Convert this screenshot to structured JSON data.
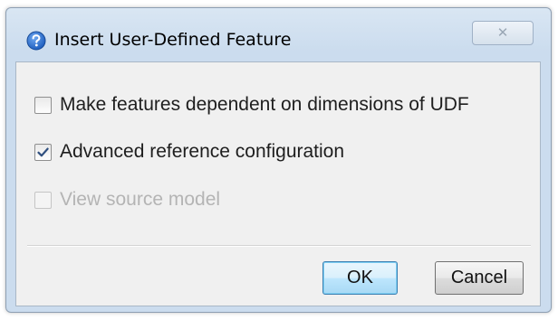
{
  "window": {
    "title": "Insert User-Defined Feature",
    "close_symbol": "✕"
  },
  "options": [
    {
      "label": "Make features dependent on dimensions of UDF",
      "checked": false,
      "enabled": true
    },
    {
      "label": "Advanced reference configuration",
      "checked": true,
      "enabled": true
    },
    {
      "label": "View source model",
      "checked": false,
      "enabled": false
    }
  ],
  "buttons": {
    "ok_label": "OK",
    "cancel_label": "Cancel"
  },
  "icons": {
    "title_icon": "help-question-icon",
    "check_icon": "checkmark-icon",
    "close_icon": "close-icon"
  },
  "colors": {
    "title_bar": "#cbdcee",
    "content_bg": "#f0f0f0",
    "help_icon_blue": "#1f5fbf",
    "check_mark": "#2f4f7f",
    "ok_focus_border": "#3c7fb1",
    "disabled_text": "#b4b4b4"
  }
}
